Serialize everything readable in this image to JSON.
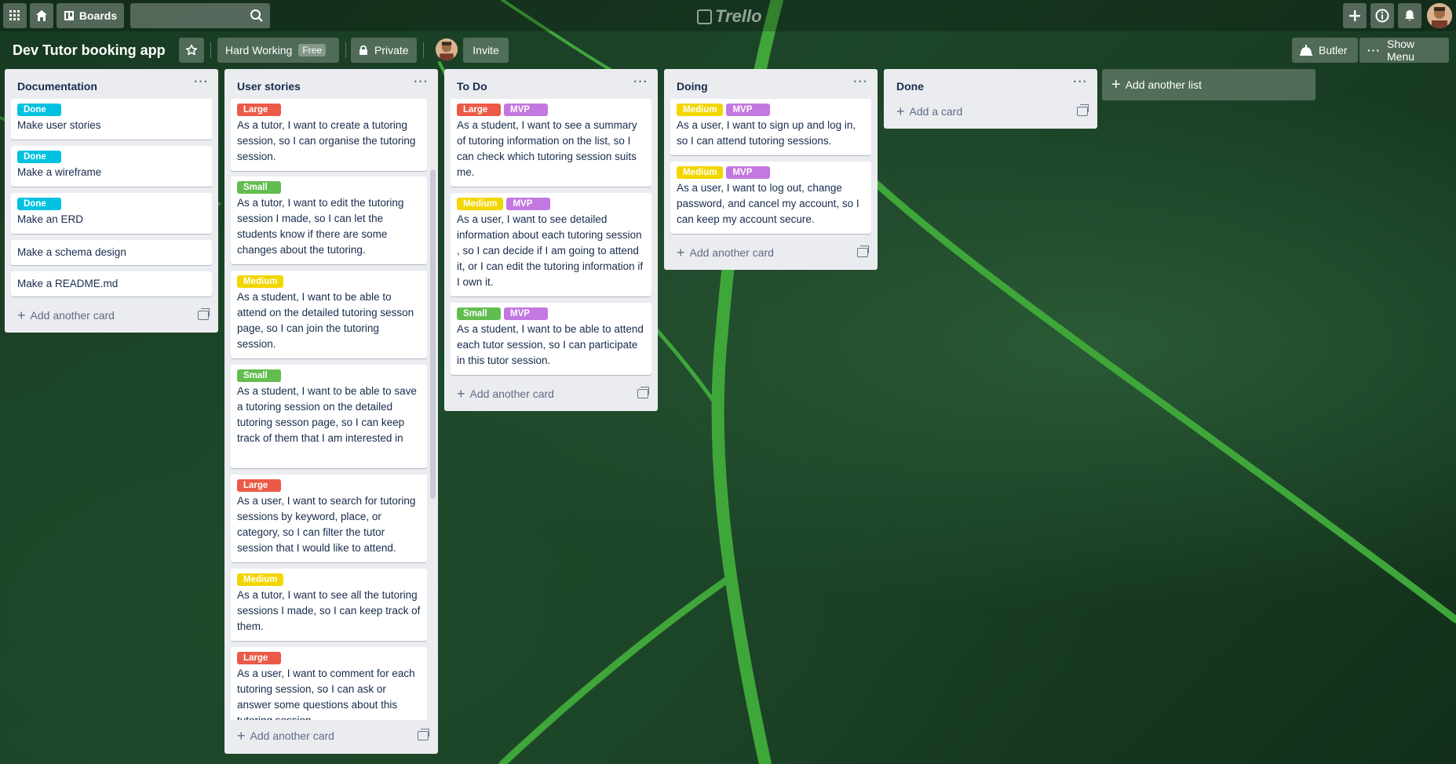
{
  "colors": {
    "label_done": "#00c2e0",
    "label_large": "#eb5a46",
    "label_small": "#61bd4f",
    "label_medium": "#f2d600",
    "label_mvp": "#c377e0",
    "list_bg": "#ebecf0"
  },
  "nav": {
    "boards_label": "Boards",
    "search_placeholder": "",
    "logo_text": "Trello"
  },
  "board": {
    "title": "Dev Tutor booking app",
    "workspace_label": "Hard Working",
    "workspace_badge": "Free",
    "visibility_label": "Private",
    "invite_label": "Invite",
    "butler_label": "Butler",
    "menu_label": "Show Menu"
  },
  "lists": [
    {
      "name": "Documentation",
      "add_label": "Add another card",
      "cards": [
        {
          "labels": [
            "Done"
          ],
          "text": "Make user stories"
        },
        {
          "labels": [
            "Done"
          ],
          "text": "Make a wireframe"
        },
        {
          "labels": [
            "Done"
          ],
          "text": "Make an ERD"
        },
        {
          "labels": [],
          "text": "Make a schema design"
        },
        {
          "labels": [],
          "text": "Make a README.md"
        }
      ]
    },
    {
      "name": "User stories",
      "add_label": "Add another card",
      "cards": [
        {
          "labels": [
            "Large"
          ],
          "text": "As a tutor, I want to create a tutoring session, so I can organise the tutoring session."
        },
        {
          "labels": [
            "Small"
          ],
          "text": "As a tutor, I want to edit the tutoring session I made, so I can let the students know if there are some changes about the tutoring."
        },
        {
          "labels": [
            "Medium"
          ],
          "text": "As a student, I want to be able to attend on the detailed tutoring sesson page, so I can join the tutoring session."
        },
        {
          "labels": [
            "Small"
          ],
          "text": "As a student, I want to be able to save a tutoring session on the detailed tutoring sesson page, so I can keep track of them that I am interested in"
        },
        {
          "labels": [
            "Large"
          ],
          "text": "As a user, I want to search for tutoring sessions by keyword, place, or category, so I can filter the tutor session that I would like to attend."
        },
        {
          "labels": [
            "Medium"
          ],
          "text": "As a tutor, I want to see all the tutoring sessions I made, so I can keep track of them."
        },
        {
          "labels": [
            "Large"
          ],
          "text": "As a user, I want to comment for each tutoring session, so I can ask or answer some questions about this tutoring session."
        }
      ]
    },
    {
      "name": "To Do",
      "add_label": "Add another card",
      "cards": [
        {
          "labels": [
            "Large",
            "MVP"
          ],
          "text": "As a student, I want to see a summary of tutoring information on the list, so I can check which tutoring session suits me."
        },
        {
          "labels": [
            "Medium",
            "MVP"
          ],
          "text": "As a user, I want to see detailed information about each tutoring session , so I can decide if I am going to attend it, or I can edit the tutoring information if I own it."
        },
        {
          "labels": [
            "Small",
            "MVP"
          ],
          "text": "As a student, I want to be able to attend each tutor session, so I can participate in this tutor session."
        }
      ]
    },
    {
      "name": "Doing",
      "add_label": "Add another card",
      "cards": [
        {
          "labels": [
            "Medium",
            "MVP"
          ],
          "text": "As a user, I want to sign up and log in, so I can attend tutoring sessions."
        },
        {
          "labels": [
            "Medium",
            "MVP"
          ],
          "text": "As a user, I want to log out, change password, and cancel my account, so I can keep my account secure."
        }
      ]
    },
    {
      "name": "Done",
      "add_label": "Add a card",
      "cards": []
    }
  ],
  "add_list_label": "Add another list"
}
